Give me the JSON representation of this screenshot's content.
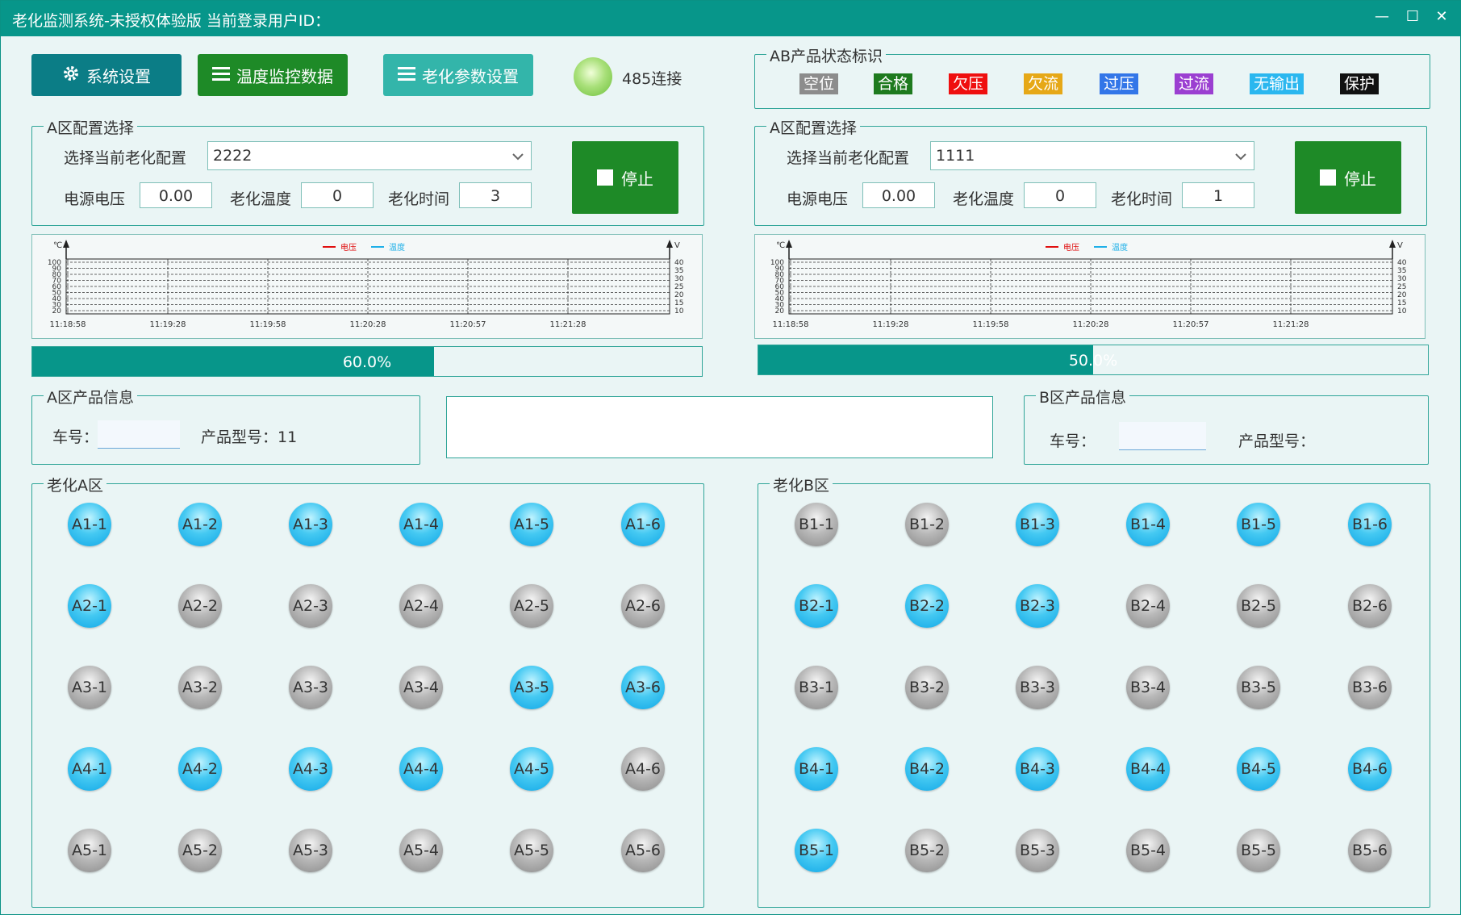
{
  "window": {
    "title": "老化监测系统-未授权体验版 当前登录用户ID：",
    "buttons": {
      "minimize": "—",
      "maximize": "☐",
      "close": "✕"
    }
  },
  "toolbar": {
    "settings_label": "系统设置",
    "temp_label": "温度监控数据",
    "params_label": "老化参数设置",
    "connection_label": "485连接"
  },
  "status_legend": {
    "title": "AB产品状态标识",
    "items": [
      {
        "label": "空位",
        "color": "#8c8c8c"
      },
      {
        "label": "合格",
        "color": "#1e7a1e"
      },
      {
        "label": "欠压",
        "color": "#ef0f0f"
      },
      {
        "label": "欠流",
        "color": "#e6a817"
      },
      {
        "label": "过压",
        "color": "#3376e8"
      },
      {
        "label": "过流",
        "color": "#9b3fd1"
      },
      {
        "label": "无输出",
        "color": "#2bb7ef"
      },
      {
        "label": "保护",
        "color": "#111111"
      }
    ]
  },
  "config_a": {
    "title": "A区配置选择",
    "select_label": "选择当前老化配置",
    "select_value": "2222",
    "voltage_label": "电源电压",
    "voltage_value": "0.00",
    "temp_label": "老化温度",
    "temp_value": "0",
    "time_label": "老化时间",
    "time_value": "3",
    "stop_label": "停止"
  },
  "config_b": {
    "title": "A区配置选择",
    "select_label": "选择当前老化配置",
    "select_value": "1111",
    "voltage_label": "电源电压",
    "voltage_value": "0.00",
    "temp_label": "老化温度",
    "temp_value": "0",
    "time_label": "老化时间",
    "time_value": "1",
    "stop_label": "停止"
  },
  "charts": {
    "left_unit": "℃",
    "right_unit": "V",
    "legend": [
      "电压",
      "温度"
    ],
    "legend_colors": [
      "#e01010",
      "#1fb0e8"
    ],
    "left_ticks": [
      "100",
      "90",
      "80",
      "70",
      "60",
      "50",
      "40",
      "30",
      "20"
    ],
    "right_ticks": [
      "40",
      "35",
      "30",
      "25",
      "20",
      "15",
      "10"
    ],
    "x_ticks": [
      "11:18:58",
      "11:19:28",
      "11:19:58",
      "11:20:28",
      "11:20:57",
      "11:21:28"
    ]
  },
  "progress_a": {
    "text": "60.0%",
    "value": 0.6
  },
  "progress_b": {
    "text": "50.0%",
    "value": 0.5
  },
  "product_a": {
    "title": "A区产品信息",
    "car_label": "车号：",
    "model_label": "产品型号：11"
  },
  "product_b": {
    "title": "B区产品信息",
    "car_label": "车号：",
    "model_label": "产品型号："
  },
  "zone_a": {
    "title": "老化A区",
    "rows": [
      [
        {
          "label": "A1-1",
          "on": true
        },
        {
          "label": "A1-2",
          "on": true
        },
        {
          "label": "A1-3",
          "on": true
        },
        {
          "label": "A1-4",
          "on": true
        },
        {
          "label": "A1-5",
          "on": true
        },
        {
          "label": "A1-6",
          "on": true
        }
      ],
      [
        {
          "label": "A2-1",
          "on": true
        },
        {
          "label": "A2-2",
          "on": false
        },
        {
          "label": "A2-3",
          "on": false
        },
        {
          "label": "A2-4",
          "on": false
        },
        {
          "label": "A2-5",
          "on": false
        },
        {
          "label": "A2-6",
          "on": false
        }
      ],
      [
        {
          "label": "A3-1",
          "on": false
        },
        {
          "label": "A3-2",
          "on": false
        },
        {
          "label": "A3-3",
          "on": false
        },
        {
          "label": "A3-4",
          "on": false
        },
        {
          "label": "A3-5",
          "on": true
        },
        {
          "label": "A3-6",
          "on": true
        }
      ],
      [
        {
          "label": "A4-1",
          "on": true
        },
        {
          "label": "A4-2",
          "on": true
        },
        {
          "label": "A4-3",
          "on": true
        },
        {
          "label": "A4-4",
          "on": true
        },
        {
          "label": "A4-5",
          "on": true
        },
        {
          "label": "A4-6",
          "on": false
        }
      ],
      [
        {
          "label": "A5-1",
          "on": false
        },
        {
          "label": "A5-2",
          "on": false
        },
        {
          "label": "A5-3",
          "on": false
        },
        {
          "label": "A5-4",
          "on": false
        },
        {
          "label": "A5-5",
          "on": false
        },
        {
          "label": "A5-6",
          "on": false
        }
      ]
    ]
  },
  "zone_b": {
    "title": "老化B区",
    "rows": [
      [
        {
          "label": "B1-1",
          "on": false
        },
        {
          "label": "B1-2",
          "on": false
        },
        {
          "label": "B1-3",
          "on": true
        },
        {
          "label": "B1-4",
          "on": true
        },
        {
          "label": "B1-5",
          "on": true
        },
        {
          "label": "B1-6",
          "on": true
        }
      ],
      [
        {
          "label": "B2-1",
          "on": true
        },
        {
          "label": "B2-2",
          "on": true
        },
        {
          "label": "B2-3",
          "on": true
        },
        {
          "label": "B2-4",
          "on": false
        },
        {
          "label": "B2-5",
          "on": false
        },
        {
          "label": "B2-6",
          "on": false
        }
      ],
      [
        {
          "label": "B3-1",
          "on": false
        },
        {
          "label": "B3-2",
          "on": false
        },
        {
          "label": "B3-3",
          "on": false
        },
        {
          "label": "B3-4",
          "on": false
        },
        {
          "label": "B3-5",
          "on": false
        },
        {
          "label": "B3-6",
          "on": false
        }
      ],
      [
        {
          "label": "B4-1",
          "on": true
        },
        {
          "label": "B4-2",
          "on": true
        },
        {
          "label": "B4-3",
          "on": true
        },
        {
          "label": "B4-4",
          "on": true
        },
        {
          "label": "B4-5",
          "on": true
        },
        {
          "label": "B4-6",
          "on": true
        }
      ],
      [
        {
          "label": "B5-1",
          "on": true
        },
        {
          "label": "B5-2",
          "on": false
        },
        {
          "label": "B5-3",
          "on": false
        },
        {
          "label": "B5-4",
          "on": false
        },
        {
          "label": "B5-5",
          "on": false
        },
        {
          "label": "B5-6",
          "on": false
        }
      ]
    ]
  }
}
